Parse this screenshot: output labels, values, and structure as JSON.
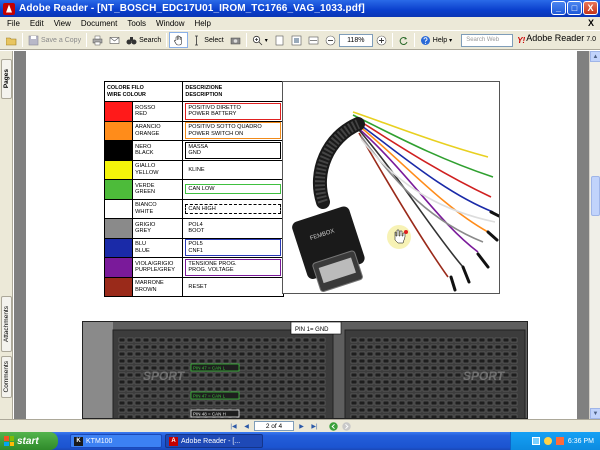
{
  "window": {
    "title": "Adobe Reader - [NT_BOSCH_EDC17U01_IROM_TC1766_VAG_1033.pdf]",
    "minimize": "_",
    "maximize": "□",
    "close": "X"
  },
  "menu": {
    "items": [
      "File",
      "Edit",
      "View",
      "Document",
      "Tools",
      "Window",
      "Help"
    ],
    "doc_close": "X"
  },
  "toolbar": {
    "save_copy": "Save a Copy",
    "search": "Search",
    "select": "Select",
    "zoom": "118%",
    "help": "Help",
    "search_web_placeholder": "Search Web",
    "yahoo": "Y!",
    "brand": "Adobe Reader",
    "version": "7.0"
  },
  "leftnav": {
    "pages": "Pages",
    "attachments": "Attachments",
    "comments": "Comments"
  },
  "document": {
    "table_header": {
      "col1": [
        "COLORE FILO",
        "WIRE COLOUR"
      ],
      "col2": [
        "DESCRIZIONE",
        "DESCRIPTION"
      ]
    },
    "wires": [
      {
        "it": "ROSSO",
        "en": "RED",
        "swatch": "#ff1a1a",
        "border": "#e02020",
        "desc1": "POSITIVO DIRETTO",
        "desc2": "POWER BATTERY"
      },
      {
        "it": "ARANCIO",
        "en": "ORANGE",
        "swatch": "#ff8c1a",
        "border": "#f08a1a",
        "desc1": "POSITIVO SOTTO QUADRO",
        "desc2": "POWER SWITCH ON"
      },
      {
        "it": "NERO",
        "en": "BLACK",
        "swatch": "#000000",
        "border": "#000000",
        "desc1": "MASSA",
        "desc2": "GND"
      },
      {
        "it": "GIALLO",
        "en": "YELLOW",
        "swatch": "#f4f40a",
        "border": "",
        "desc1": "KLINE",
        "desc2": ""
      },
      {
        "it": "VERDE",
        "en": "GREEN",
        "swatch": "#4dbb3a",
        "border": "#40c040",
        "desc1": "CAN LOW",
        "desc2": ""
      },
      {
        "it": "BIANCO",
        "en": "WHITE",
        "swatch": "#ffffff",
        "border": "#000000",
        "desc1": "CAN HIGH",
        "desc2": ""
      },
      {
        "it": "GRIGIO",
        "en": "GREY",
        "swatch": "#8a8a8a",
        "border": "",
        "desc1": "POL4",
        "desc2": "BOOT"
      },
      {
        "it": "BLU",
        "en": "BLUE",
        "swatch": "#1a2aa8",
        "border": "#2a3ab8",
        "desc1": "POL5",
        "desc2": "CNF1"
      },
      {
        "it": "VIOLA/GRIGIO",
        "en": "PURPLE/GREY",
        "swatch": "#7a1a9a",
        "border": "#7a1a9a",
        "desc1": "TENSIONE PROG.",
        "desc2": "PROG. VOLTAGE"
      },
      {
        "it": "MARRONE",
        "en": "BROWN",
        "swatch": "#9a2a1a",
        "border": "",
        "desc1": "RESET",
        "desc2": ""
      }
    ],
    "connector_label": "FEMBOX",
    "ecu_pin_label": "PIN 1= GND",
    "ecu_can_label_1": "PIN 47 = CAN L",
    "ecu_can_label_2": "PIN 47 = CAN L",
    "ecu_can_label_3": "PIN 48 = CAN H",
    "watermark": "SPORT"
  },
  "statusbar": {
    "page_field": "2 of 4"
  },
  "taskbar": {
    "start": "start",
    "items": [
      {
        "label": "KTM100",
        "active": false
      },
      {
        "label": "Adobe Reader - [...",
        "active": true
      }
    ],
    "clock": "6:36 PM"
  },
  "colors": {
    "title_blue": "#0a3fcc",
    "chrome": "#ece9d8",
    "taskbar_blue": "#245edb",
    "start_green": "#3f9e38"
  }
}
